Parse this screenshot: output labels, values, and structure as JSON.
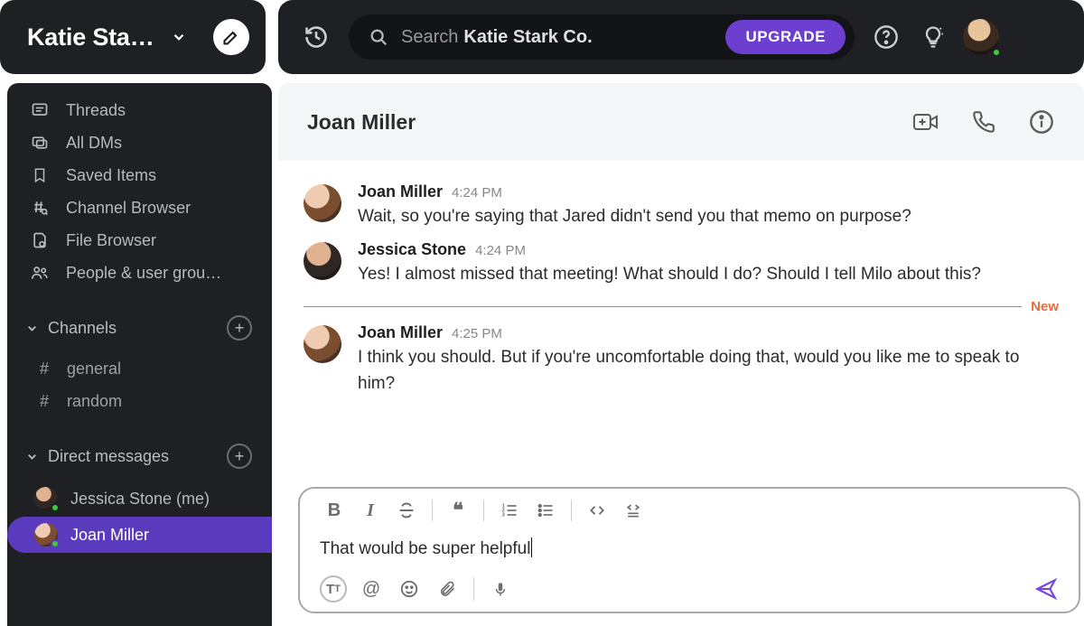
{
  "workspace": {
    "name": "Katie Sta…"
  },
  "search": {
    "label": "Search",
    "context": "Katie Stark Co."
  },
  "upgrade_label": "UPGRADE",
  "sidebar": {
    "items": [
      {
        "icon": "threads",
        "label": "Threads"
      },
      {
        "icon": "all-dms",
        "label": "All DMs"
      },
      {
        "icon": "bookmark",
        "label": "Saved Items"
      },
      {
        "icon": "channel-browser",
        "label": "Channel Browser"
      },
      {
        "icon": "file-browser",
        "label": "File Browser"
      },
      {
        "icon": "people",
        "label": "People & user grou…"
      }
    ],
    "sections": {
      "channels": {
        "label": "Channels",
        "items": [
          "general",
          "random"
        ]
      },
      "dms": {
        "label": "Direct messages",
        "items": [
          {
            "name": "Jessica Stone (me)",
            "active": false,
            "avatar": "jessica"
          },
          {
            "name": "Joan Miller",
            "active": true,
            "avatar": "joan"
          }
        ]
      }
    }
  },
  "conversation": {
    "title": "Joan Miller",
    "messages": [
      {
        "author": "Joan Miller",
        "time": "4:24 PM",
        "avatar": "joan",
        "text": "Wait, so you're saying that Jared didn't send you that memo on purpose?"
      },
      {
        "author": "Jessica Stone",
        "time": "4:24 PM",
        "avatar": "jessica",
        "text": "Yes! I almost missed that meeting! What should I do? Should I tell Milo about this?"
      },
      {
        "author": "Joan Miller",
        "time": "4:25 PM",
        "avatar": "joan",
        "text": "I think you should. But if you're uncomfortable doing that, would you like me to speak to him?"
      }
    ],
    "divider_label": "New",
    "composer": {
      "typed": "That would be super helpful"
    }
  }
}
